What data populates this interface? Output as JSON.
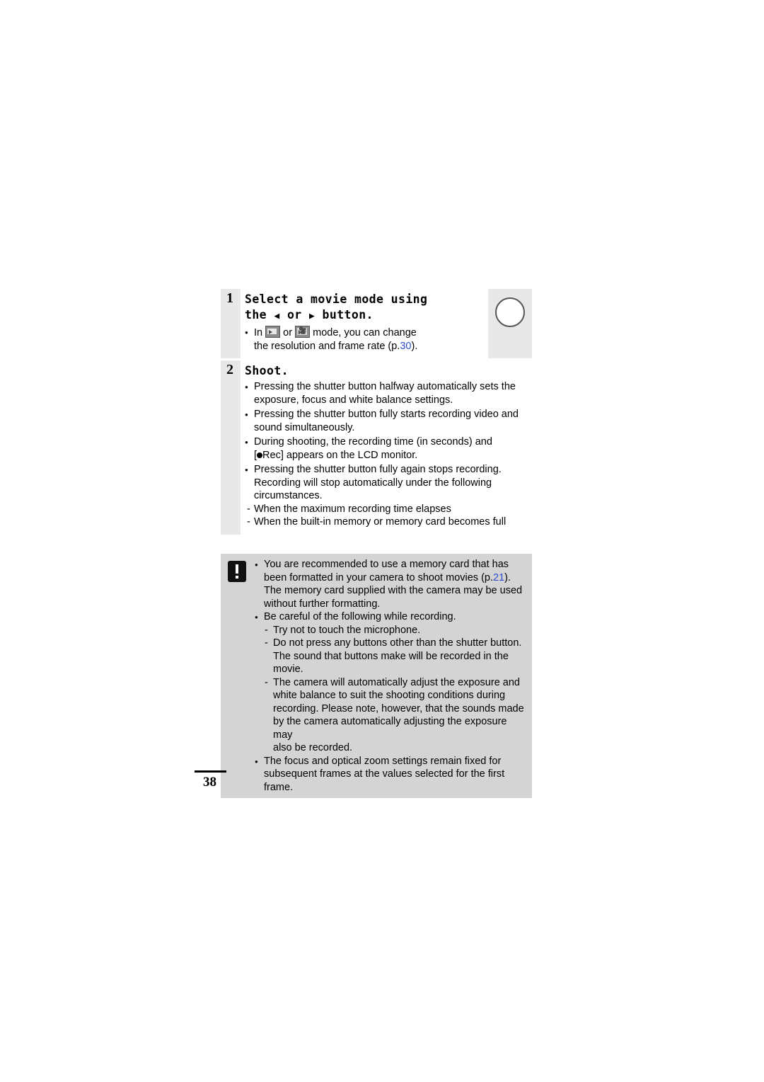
{
  "page": {
    "number": "38"
  },
  "steps": [
    {
      "number": "1",
      "title_line1": "Select a movie mode using",
      "title_line2_pre": "the",
      "title_line2_mid": "or",
      "title_line2_post": "button.",
      "title_arrow_left": "◀",
      "title_arrow_right": "▶",
      "bullets": [
        {
          "pre": "In",
          "icon1": "movie-mode-icon",
          "mid": "or",
          "icon2": "movie-standard-icon",
          "post": "mode, you can change",
          "line2_pre": "the resolution and frame rate (p.",
          "line2_ref": "30",
          "line2_post": ")."
        }
      ]
    },
    {
      "number": "2",
      "title_line1": "Shoot.",
      "bullets": [
        {
          "lines": [
            "Pressing the shutter button halfway automatically sets the",
            "exposure, focus and white balance settings."
          ]
        },
        {
          "lines": [
            "Pressing the shutter button fully starts recording video and",
            "sound simultaneously."
          ]
        },
        {
          "lines": [
            "During shooting, the recording time (in seconds) and"
          ],
          "rec_line_pre": "[",
          "rec_line_post": "Rec] appears on the LCD monitor."
        },
        {
          "lines": [
            "Pressing the shutter button fully again stops recording.",
            "Recording will stop automatically under the following",
            "circumstances."
          ],
          "dashes": [
            "When the maximum recording time elapses",
            "When the built-in memory or memory card becomes full"
          ]
        }
      ]
    }
  ],
  "note": {
    "icon": "caution-icon",
    "items": [
      {
        "type": "bullet",
        "lines": [
          "You are recommended to use a memory card that has"
        ],
        "ref_line_pre": "been formatted in your camera to shoot movies (p.",
        "ref_line_num": "21",
        "ref_line_post": ").",
        "tail_lines": [
          "The memory card supplied with the camera may be used",
          "without further formatting."
        ]
      },
      {
        "type": "bullet",
        "lines": [
          "Be careful of the following while recording."
        ],
        "dashes": [
          {
            "lines": [
              "Try not to touch the microphone."
            ]
          },
          {
            "lines": [
              "Do not press any buttons other than the shutter button.",
              "The sound that buttons make will be recorded in the",
              "movie."
            ]
          },
          {
            "lines": [
              "The camera will automatically adjust the exposure and",
              "white balance to suit the shooting conditions during",
              "recording. Please note, however, that the sounds made",
              "by the camera automatically adjusting the exposure may",
              "also be recorded."
            ]
          }
        ]
      },
      {
        "type": "bullet",
        "lines": [
          "The focus and optical zoom settings remain fixed for",
          "subsequent frames at the values selected for the first",
          "frame."
        ]
      }
    ]
  }
}
